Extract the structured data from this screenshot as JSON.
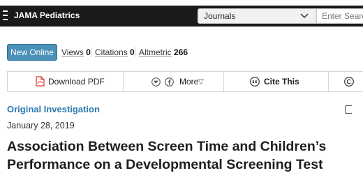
{
  "topbar": {
    "brand": "JAMA Pediatrics",
    "journals_selected": "Journals",
    "search_placeholder": "Enter Search Term"
  },
  "metrics": {
    "new_online_label": "New Online",
    "views_label": "Views",
    "views_value": "0",
    "citations_label": "Citations",
    "citations_value": "0",
    "altmetric_label": "Altmetric",
    "altmetric_value": "266"
  },
  "toolbar": {
    "download_pdf_label": "Download PDF",
    "more_label": "More",
    "more_caret": "▽",
    "cite_this_label": "Cite This"
  },
  "article": {
    "type": "Original Investigation",
    "date": "January 28, 2019",
    "title_line1": "Association Between Screen Time and Children’s",
    "title_line2": "Performance on a Developmental Screening Test"
  },
  "colors": {
    "topbar_bg": "#1a1a1a",
    "new_online_bg": "#4a90b8",
    "article_type": "#2a7ab0",
    "pdf_red": "#d9342b"
  }
}
